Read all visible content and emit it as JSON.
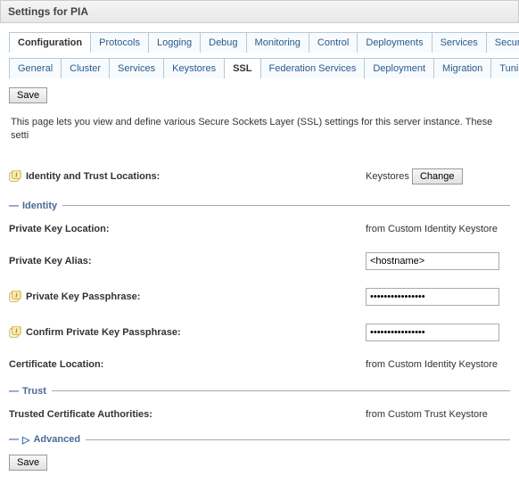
{
  "titleBar": "Settings for PIA",
  "mainTabs": [
    "Configuration",
    "Protocols",
    "Logging",
    "Debug",
    "Monitoring",
    "Control",
    "Deployments",
    "Services",
    "Security"
  ],
  "mainActive": "Configuration",
  "subTabs": [
    "General",
    "Cluster",
    "Services",
    "Keystores",
    "SSL",
    "Federation Services",
    "Deployment",
    "Migration",
    "Tuning"
  ],
  "subActive": "SSL",
  "saveLabel": "Save",
  "description": "This page lets you view and define various Secure Sockets Layer (SSL) settings for this server instance. These setti",
  "identityTrust": {
    "label": "Identity and Trust Locations:",
    "valuePrefix": "Keystores",
    "changeLabel": "Change"
  },
  "sections": {
    "identity": "Identity",
    "trust": "Trust",
    "advanced": "Advanced"
  },
  "fields": {
    "privateKeyLocation": {
      "label": "Private Key Location:",
      "value": "from Custom Identity Keystore"
    },
    "privateKeyAlias": {
      "label": "Private Key Alias:",
      "value": "<hostname>"
    },
    "privateKeyPassphrase": {
      "label": "Private Key Passphrase:",
      "value": "••••••••••••••••"
    },
    "confirmPassphrase": {
      "label": "Confirm Private Key Passphrase:",
      "value": "••••••••••••••••"
    },
    "certificateLocation": {
      "label": "Certificate Location:",
      "value": "from Custom Identity Keystore"
    },
    "trustedCAs": {
      "label": "Trusted Certificate Authorities:",
      "value": "from Custom Trust Keystore"
    }
  }
}
